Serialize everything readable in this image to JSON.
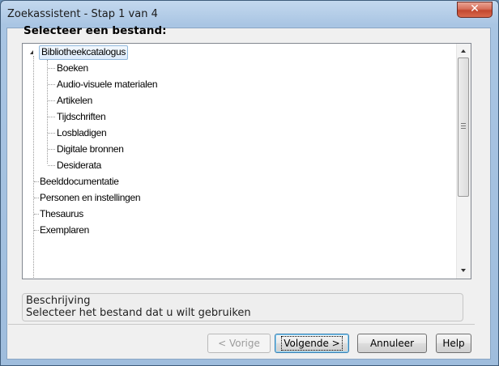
{
  "window": {
    "title": "Zoekassistent - Stap 1 van 4",
    "close_glyph": "✕"
  },
  "heading": "Selecteer een bestand:",
  "tree": {
    "root": "Bibliotheekcatalogus",
    "children": [
      "Boeken",
      "Audio-visuele materialen",
      "Artikelen",
      "Tijdschriften",
      "Losbladigen",
      "Digitale bronnen",
      "Desiderata"
    ],
    "siblings": [
      "Beelddocumentatie",
      "Personen en instellingen",
      "Thesaurus",
      "Exemplaren"
    ]
  },
  "description": {
    "label": "Beschrijving",
    "text": "Selecteer het bestand dat u wilt gebruiken"
  },
  "buttons": {
    "prev": "< Vorige",
    "next": "Volgende >",
    "cancel": "Annuleer",
    "help": "Help"
  },
  "colors": {
    "titlebar": "#a9c5e3",
    "close_button": "#c2472f",
    "selection": "#dcebfb"
  },
  "icons": [
    "close-icon",
    "expander-arrow-icon",
    "scroll-up-icon",
    "scroll-down-icon"
  ]
}
